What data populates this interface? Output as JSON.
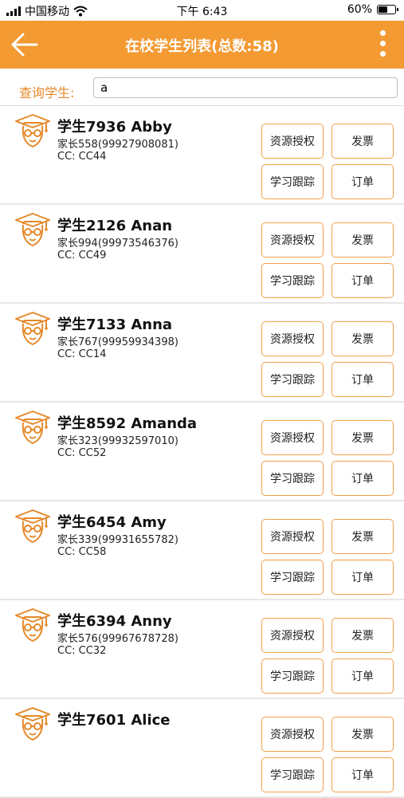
{
  "status_bar": {
    "carrier": "中国移动",
    "time": "下午 6:43",
    "battery": "60%",
    "battery_level": 0.6
  },
  "header": {
    "title": "在校学生列表(总数:58)",
    "back_icon": "back-arrow-icon",
    "more_icon": "more-vertical-icon"
  },
  "search": {
    "label": "查询学生:",
    "value": "a"
  },
  "actions": {
    "resource": "资源授权",
    "invoice": "发票",
    "tracking": "学习跟踪",
    "order": "订单"
  },
  "students": [
    {
      "name": "学生7936 Abby",
      "parent": "家长558(99927908081)",
      "cc": "CC: CC44"
    },
    {
      "name": "学生2126 Anan",
      "parent": "家长994(99973546376)",
      "cc": "CC: CC49"
    },
    {
      "name": "学生7133 Anna",
      "parent": "家长767(99959934398)",
      "cc": "CC: CC14"
    },
    {
      "name": "学生8592 Amanda",
      "parent": "家长323(99932597010)",
      "cc": "CC: CC52"
    },
    {
      "name": "学生6454 Amy",
      "parent": "家长339(99931655782)",
      "cc": "CC: CC58"
    },
    {
      "name": "学生6394 Anny",
      "parent": "家长576(99967678728)",
      "cc": "CC: CC32"
    },
    {
      "name": "学生7601 Alice",
      "parent": "",
      "cc": ""
    }
  ],
  "colors": {
    "accent": "#f39a33",
    "button_border": "#f0a04b",
    "label": "#e5892a"
  }
}
